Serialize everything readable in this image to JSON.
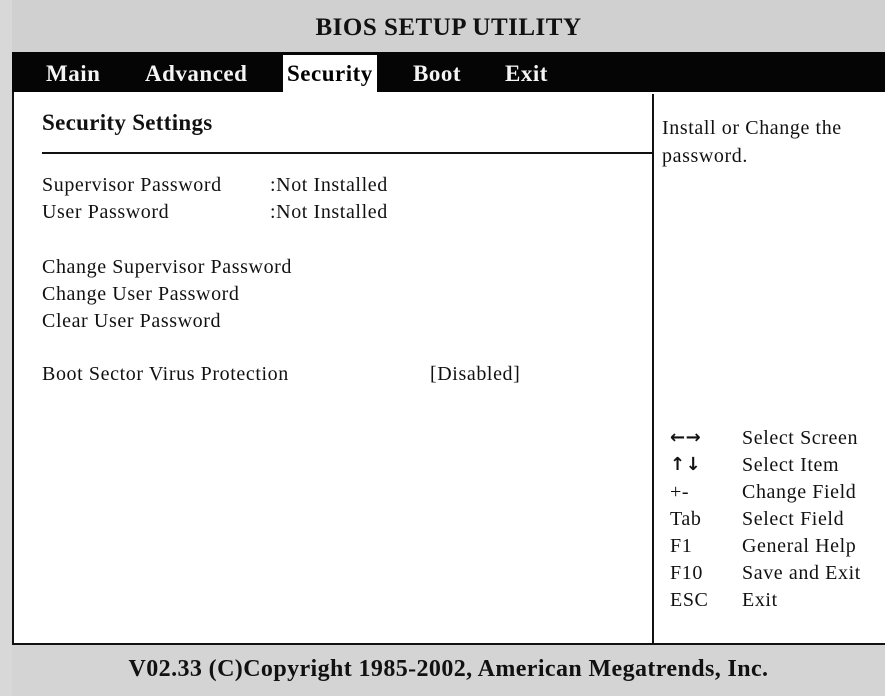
{
  "title": "BIOS SETUP UTILITY",
  "menu": [
    {
      "label": "Main",
      "active": false
    },
    {
      "label": "Advanced",
      "active": false
    },
    {
      "label": "Security",
      "active": true
    },
    {
      "label": "Boot",
      "active": false
    },
    {
      "label": "Exit",
      "active": false
    }
  ],
  "section_title": "Security Settings",
  "status_rows": [
    {
      "label": "Supervisor Password",
      "value": ":Not Installed"
    },
    {
      "label": "User Password",
      "value": ":Not Installed"
    }
  ],
  "actions": [
    "Change Supervisor Password",
    "Change User Password",
    "Clear User Password"
  ],
  "option": {
    "label": "Boot Sector Virus Protection",
    "value": "[Disabled]"
  },
  "help": "Install or Change the password.",
  "keys": [
    {
      "key": "←→",
      "desc": "Select Screen",
      "icon": "left-right-arrow-icon"
    },
    {
      "key": "↑↓",
      "desc": "Select Item",
      "icon": "up-down-arrow-icon"
    },
    {
      "key": "+-",
      "desc": "Change Field"
    },
    {
      "key": "Tab",
      "desc": "Select Field"
    },
    {
      "key": "F1",
      "desc": "General Help"
    },
    {
      "key": "F10",
      "desc": "Save and Exit"
    },
    {
      "key": "ESC",
      "desc": "Exit"
    }
  ],
  "footer": "V02.33 (C)Copyright 1985-2002, American Megatrends, Inc."
}
